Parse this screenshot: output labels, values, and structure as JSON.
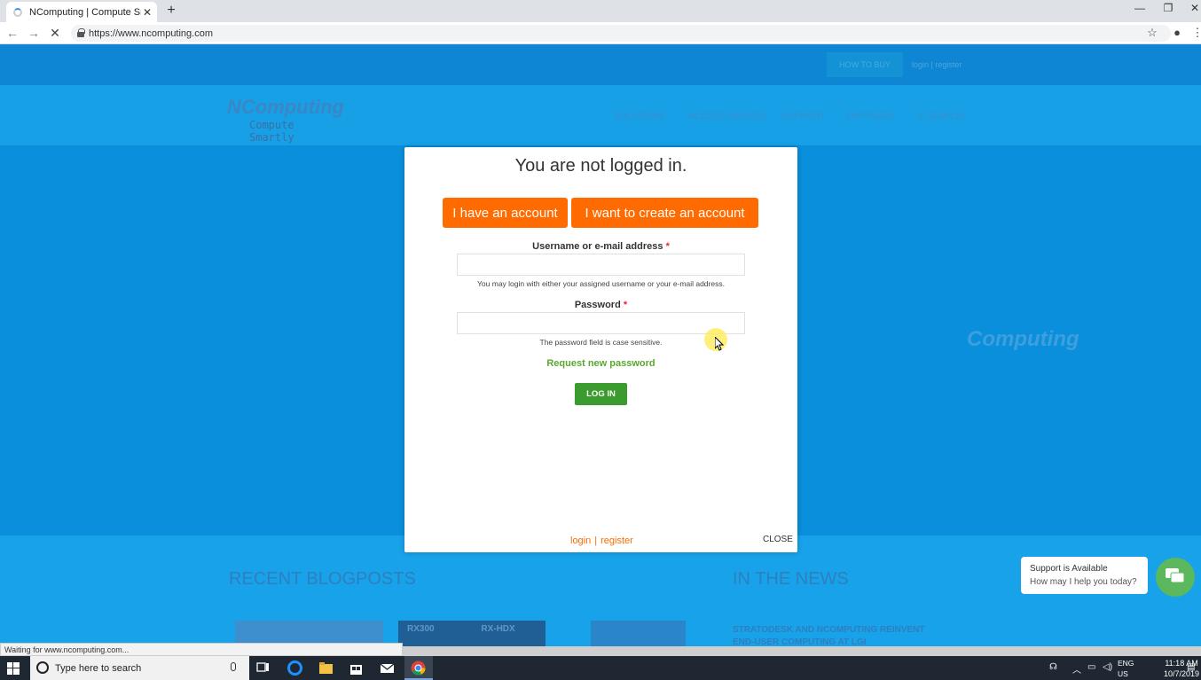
{
  "browser": {
    "tab_title": "NComputing | Compute Smartly",
    "tab_close": "✕",
    "new_tab": "+",
    "url": "https://www.ncomputing.com",
    "status": "Waiting for www.ncomputing.com..."
  },
  "site": {
    "how_to_buy": "HOW TO BUY",
    "top_links": "login | register",
    "logo_main": "NComputing",
    "logo_sub": "Compute Smartly",
    "nav": [
      "SOLUTIONS",
      "ACCESS DEVICES",
      "SUPPORT",
      "PARTNERS",
      "SEARCH"
    ],
    "hero_logo": "Computing",
    "recent_title": "RECENT BLOGPOSTS",
    "news_title": "IN THE NEWS",
    "news_item": "STRATODESK AND NCOMPUTING REINVENT END-USER COMPUTING AT LGI",
    "thumb_labels": [
      "RX300",
      "RX-HDX"
    ]
  },
  "modal": {
    "title": "You are not logged in.",
    "have_account": "I have an account",
    "create_account": "I want to create an account",
    "username_label": "Username or e-mail address",
    "required_mark": "*",
    "username_help": "You may login with either your assigned username or your e-mail address.",
    "password_label": "Password",
    "password_help": "The password field is case sensitive.",
    "request_password": "Request new password",
    "login_button": "LOG IN",
    "footer_login": "login",
    "footer_sep": "|",
    "footer_register": "register",
    "close": "CLOSE"
  },
  "chat": {
    "title": "Support is Available",
    "subtitle": "How may I help you today?"
  },
  "taskbar": {
    "search_placeholder": "Type here to search",
    "lang_top": "ENG",
    "lang_bottom": "US",
    "time": "11:18 AM",
    "date": "10/7/2019"
  },
  "colors": {
    "accent_orange": "#ff6b00",
    "login_green": "#3c9b2e",
    "link_green": "#5aa82d",
    "page_blue": "#1896dd"
  }
}
